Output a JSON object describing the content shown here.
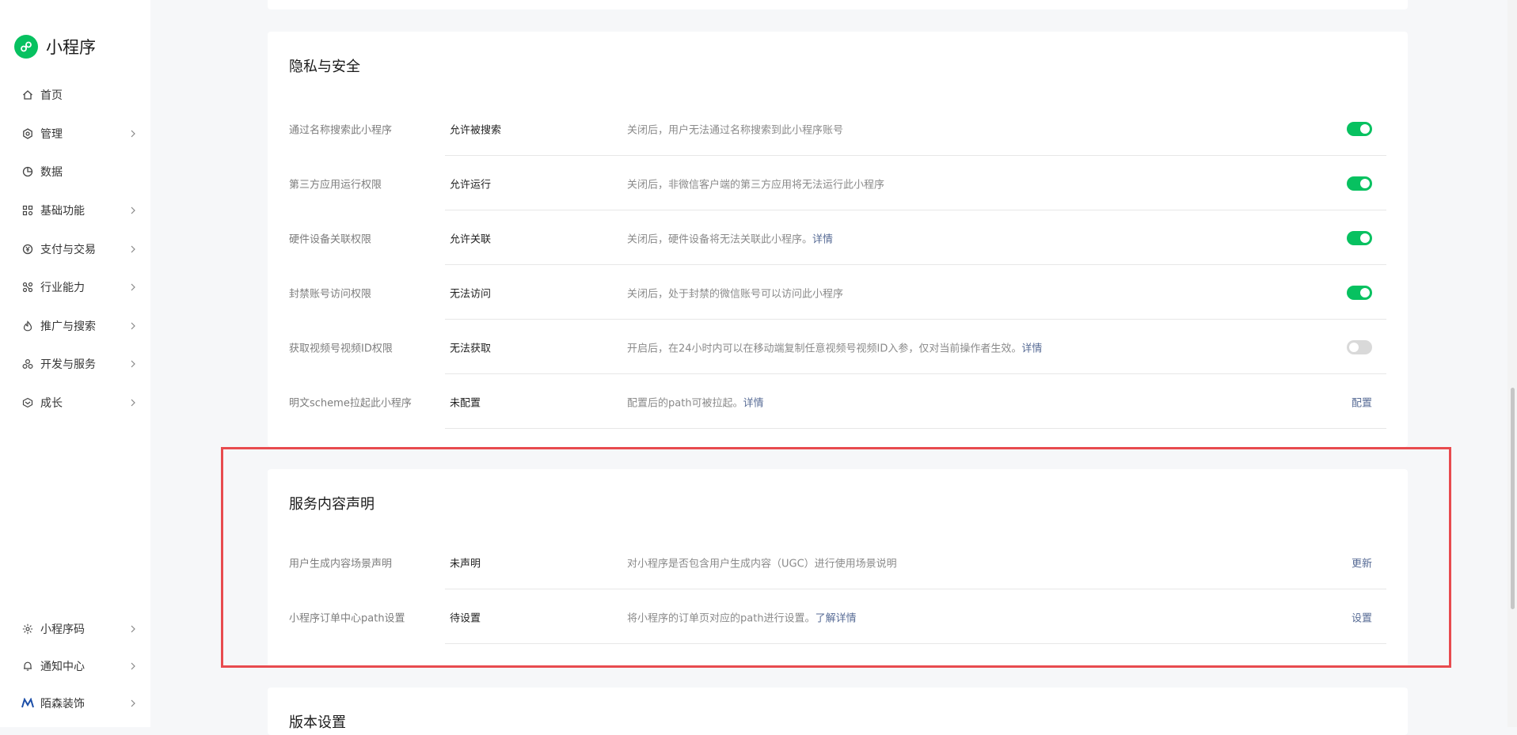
{
  "app": {
    "title": "小程序",
    "accent": "#07c160",
    "link_color": "#576b95",
    "highlight_color": "#e84b4f"
  },
  "sidebar": {
    "items": [
      {
        "label": "首页",
        "icon": "home-icon",
        "has_chevron": false
      },
      {
        "label": "管理",
        "icon": "settings-icon",
        "has_chevron": true
      },
      {
        "label": "数据",
        "icon": "pie-chart-icon",
        "has_chevron": false
      },
      {
        "label": "基础功能",
        "icon": "grid-apps-icon",
        "has_chevron": true
      },
      {
        "label": "支付与交易",
        "icon": "yen-icon",
        "has_chevron": true
      },
      {
        "label": "行业能力",
        "icon": "industry-icon",
        "has_chevron": true
      },
      {
        "label": "推广与搜索",
        "icon": "flame-icon",
        "has_chevron": true
      },
      {
        "label": "开发与服务",
        "icon": "dev-icon",
        "has_chevron": true
      },
      {
        "label": "成长",
        "icon": "growth-icon",
        "has_chevron": true
      }
    ],
    "bottom_items": [
      {
        "label": "小程序码",
        "icon": "mini-code-icon"
      },
      {
        "label": "通知中心",
        "icon": "bell-icon"
      },
      {
        "label": "陌森装饰",
        "icon": "account-logo-icon"
      }
    ]
  },
  "privacy": {
    "title": "隐私与安全",
    "rows": [
      {
        "label": "通过名称搜索此小程序",
        "value": "允许被搜索",
        "desc": "关闭后，用户无法通过名称搜索到此小程序账号",
        "link": "",
        "toggle": "on"
      },
      {
        "label": "第三方应用运行权限",
        "value": "允许运行",
        "desc": "关闭后，非微信客户端的第三方应用将无法运行此小程序",
        "link": "",
        "toggle": "on"
      },
      {
        "label": "硬件设备关联权限",
        "value": "允许关联",
        "desc": "关闭后，硬件设备将无法关联此小程序。",
        "link": "详情",
        "toggle": "on"
      },
      {
        "label": "封禁账号访问权限",
        "value": "无法访问",
        "desc": "关闭后，处于封禁的微信账号可以访问此小程序",
        "link": "",
        "toggle": "on"
      },
      {
        "label": "获取视频号视频ID权限",
        "value": "无法获取",
        "desc": "开启后，在24小时内可以在移动端复制任意视频号视频ID入参，仅对当前操作者生效。",
        "link": "详情",
        "toggle": "off"
      },
      {
        "label": "明文scheme拉起此小程序",
        "value": "未配置",
        "desc": "配置后的path可被拉起。",
        "link": "详情",
        "action": "配置"
      }
    ]
  },
  "service": {
    "title": "服务内容声明",
    "rows": [
      {
        "label": "用户生成内容场景声明",
        "value": "未声明",
        "desc": "对小程序是否包含用户生成内容（UGC）进行使用场景说明",
        "link": "",
        "action": "更新"
      },
      {
        "label": "小程序订单中心path设置",
        "value": "待设置",
        "desc": "将小程序的订单页对应的path进行设置。",
        "link": "了解详情",
        "action": "设置"
      }
    ]
  },
  "version": {
    "title": "版本设置"
  }
}
